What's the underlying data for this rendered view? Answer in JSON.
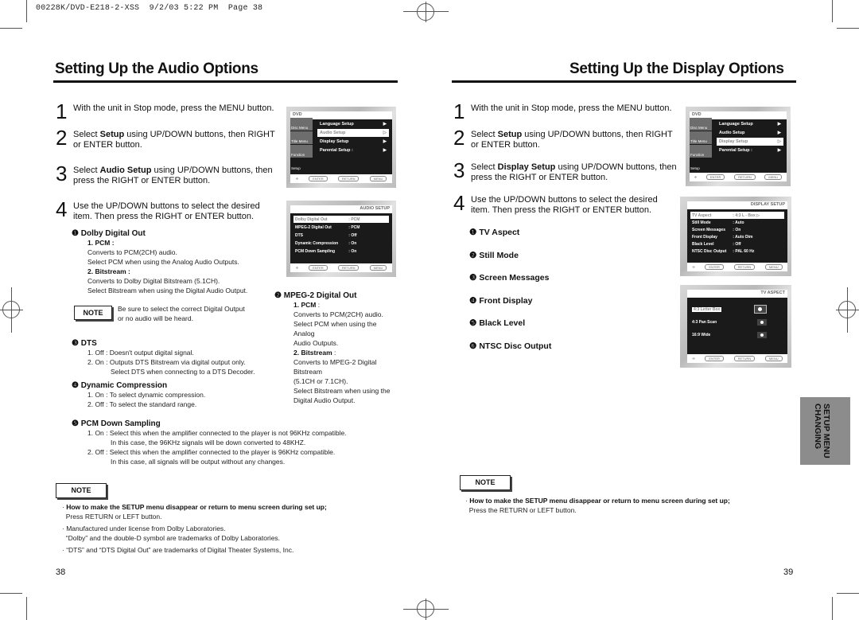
{
  "slug": "00228K/DVD-E218-2-XSS  9/2/03 5:22 PM  Page 38",
  "left_page": {
    "title": "Setting Up the Audio Options",
    "steps": [
      {
        "num": "1",
        "text": "With the unit in Stop mode, press the MENU button."
      },
      {
        "num": "2",
        "pre": "Select ",
        "bold": "Setup",
        "post": " using UP/DOWN buttons, then RIGHT or ENTER button."
      },
      {
        "num": "3",
        "pre": "Select ",
        "bold": "Audio Setup",
        "post": " using UP/DOWN buttons, then press the RIGHT or ENTER button."
      },
      {
        "num": "4",
        "text": "Use the UP/DOWN buttons to select the desired item. Then press the RIGHT or ENTER button."
      }
    ],
    "setup_screen": {
      "top_label": "DVD",
      "side": [
        "Disc Menu",
        "Title Menu",
        "Function",
        "Setup"
      ],
      "items": [
        {
          "label": "Language Setup",
          "arrow": "▶"
        },
        {
          "label": "Audio Setup",
          "arrow": "▷"
        },
        {
          "label": "Display Setup",
          "arrow": "▶"
        },
        {
          "label": "Parental Setup :",
          "arrow": "▶"
        }
      ],
      "selected": "Audio Setup",
      "footer": [
        "ENTER",
        "RETURN",
        "MENU"
      ]
    },
    "audio_screen": {
      "heading": "AUDIO SETUP",
      "rows": [
        {
          "key": "Dolby Digital Out",
          "val": ": PCM"
        },
        {
          "key": "MPEG-2 Digital Out",
          "val": ": PCM"
        },
        {
          "key": "DTS",
          "val": ": Off"
        },
        {
          "key": "Dynamic Compression",
          "val": ": On"
        },
        {
          "key": "PCM Down Sampling",
          "val": ": On"
        }
      ],
      "footer": [
        "ENTER",
        "RETURN",
        "MENU"
      ]
    },
    "sections": {
      "dolby": {
        "marker": "❶",
        "title": "Dolby Digital Out",
        "pcm_label": "1. PCM :",
        "pcm_lines": [
          "Converts to PCM(2CH) audio.",
          "Select PCM when using the Analog Audio Outputs."
        ],
        "bit_label": "2. Bitstream :",
        "bit_lines": [
          "Converts to Dolby Digital Bitstream (5.1CH).",
          "Select Bitstream when using the Digital Audio Output."
        ]
      },
      "note_inline": {
        "label": "NOTE",
        "lines": [
          "Be sure to select the correct Digital Output",
          "or no audio will be heard."
        ]
      },
      "mpeg": {
        "marker": "❷",
        "title": "MPEG-2 Digital Out",
        "pcm_label": "1. PCM",
        "pcm_lines": [
          "Converts to PCM(2CH) audio.",
          "Select PCM when using the",
          "Analog",
          "Audio Outputs."
        ],
        "bit_label": "2. Bitstream",
        "bit_lines": [
          "Converts to MPEG-2 Digital",
          "Bitstream",
          "(5.1CH or 7.1CH).",
          "Select Bitstream when using the",
          "Digital Audio Output."
        ]
      },
      "dts": {
        "marker": "❸",
        "title": "DTS",
        "lines": [
          "1. Off : Doesn't output digital signal.",
          "2. On : Outputs DTS Bitstream via digital output only.",
          "Select DTS when connecting to a DTS Decoder."
        ]
      },
      "dyn": {
        "marker": "❹",
        "title": "Dynamic Compression",
        "lines": [
          "1. On : To select dynamic compression.",
          "2. Off : To select the standard range."
        ]
      },
      "pcmds": {
        "marker": "❺",
        "title": "PCM Down Sampling",
        "lines": [
          "1. On : Select this when the amplifier connected to the player is not 96KHz compatible.",
          "In this case, the 96KHz signals will be down converted to 48KHZ.",
          "2. Off : Select this when the amplifier connected to the player is 96KHz compatible.",
          "In this case, all signals will be output without any changes."
        ]
      }
    },
    "note": {
      "label": "NOTE",
      "bullets": [
        {
          "bold": "How to make the SETUP menu disappear or return to menu screen during set up;",
          "text": "Press RETURN or LEFT button."
        },
        {
          "text": "Manufactured under license from Dolby Laboratories.",
          "text2": "“Dolby” and the double-D symbol are trademarks of Dolby Laboratories."
        },
        {
          "text": "“DTS” and “DTS Digital Out” are trademarks of Digital Theater Systems, Inc."
        }
      ]
    },
    "page_number": "38"
  },
  "right_page": {
    "title": "Setting Up the Display Options",
    "steps": [
      {
        "num": "1",
        "text": "With the unit in Stop mode, press the MENU button."
      },
      {
        "num": "2",
        "pre": "Select ",
        "bold": "Setup",
        "post": " using UP/DOWN buttons, then RIGHT or ENTER button."
      },
      {
        "num": "3",
        "pre": "Select ",
        "bold": "Display Setup",
        "post": " using UP/DOWN buttons, then press the RIGHT or ENTER button."
      },
      {
        "num": "4",
        "text": "Use the UP/DOWN buttons to select the desired item. Then press the RIGHT or ENTER button."
      }
    ],
    "items": [
      {
        "marker": "❶",
        "label": "TV Aspect"
      },
      {
        "marker": "❷",
        "label": "Still Mode"
      },
      {
        "marker": "❸",
        "label": "Screen Messages"
      },
      {
        "marker": "❹",
        "label": "Front Display"
      },
      {
        "marker": "❺",
        "label": "Black Level"
      },
      {
        "marker": "❻",
        "label": "NTSC Disc Output"
      }
    ],
    "setup_screen": {
      "top_label": "DVD",
      "side": [
        "Disc Menu",
        "Title Menu",
        "Function",
        "Setup"
      ],
      "items": [
        {
          "label": "Language Setup",
          "arrow": "▶"
        },
        {
          "label": "Audio Setup",
          "arrow": "▶"
        },
        {
          "label": "Display Setup",
          "arrow": "▷"
        },
        {
          "label": "Parental Setup :",
          "arrow": "▶"
        }
      ],
      "selected": "Display Setup",
      "footer": [
        "ENTER",
        "RETURN",
        "MENU"
      ]
    },
    "display_screen": {
      "heading": "DISPLAY SETUP",
      "rows": [
        {
          "key": "TV Aspect",
          "val": ": 4:3  L - Box   ▷"
        },
        {
          "key": "Still Mode",
          "val": ": Auto"
        },
        {
          "key": "Screen Messages",
          "val": ": On"
        },
        {
          "key": "Front Display",
          "val": ": Auto Dim"
        },
        {
          "key": "Black Level",
          "val": ": Off"
        },
        {
          "key": "NTSC Disc Output",
          "val": ": PAL 60 Hz"
        }
      ],
      "footer": [
        "ENTER",
        "RETURN",
        "MENU"
      ]
    },
    "aspect_screen": {
      "heading": "TV ASPECT",
      "options": [
        "4:3 Letter Box",
        "4:3 Pan Scan",
        "16:9 Wide"
      ],
      "selected": "4:3 Letter Box",
      "footer": [
        "ENTER",
        "RETURN",
        "MENU"
      ]
    },
    "side_tab": {
      "line1": "CHANGING",
      "line2": "SETUP MENU"
    },
    "note": {
      "label": "NOTE",
      "bold": "How to make the SETUP menu disappear or return to menu screen during set up;",
      "text": "Press the RETURN or LEFT button."
    },
    "page_number": "39"
  }
}
